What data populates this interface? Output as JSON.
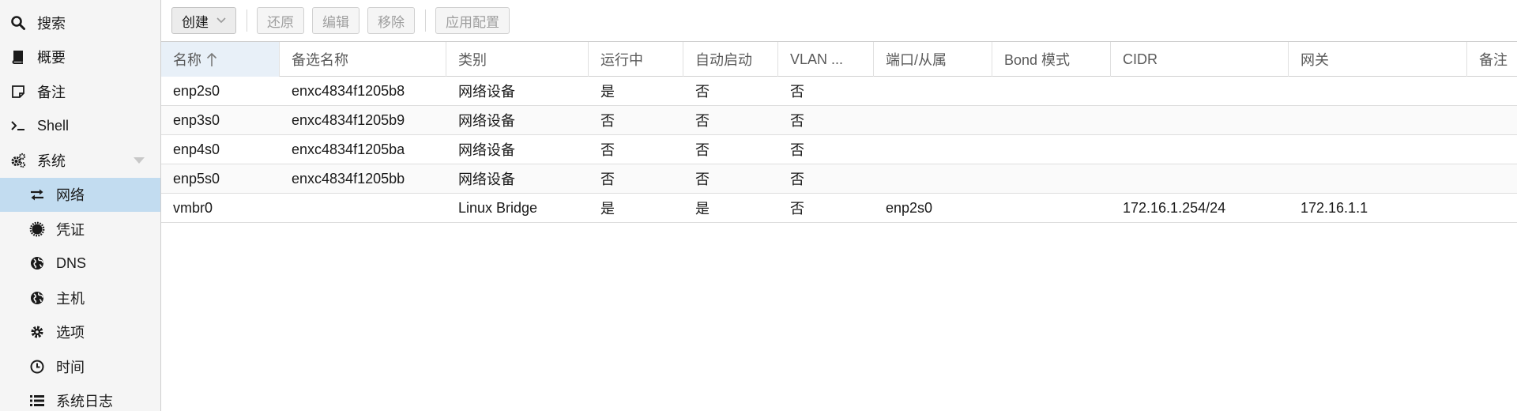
{
  "sidebar": {
    "items": [
      {
        "label": "搜索",
        "icon": "search-icon"
      },
      {
        "label": "概要",
        "icon": "book-icon"
      },
      {
        "label": "备注",
        "icon": "note-icon"
      },
      {
        "label": "Shell",
        "icon": "terminal-icon"
      },
      {
        "label": "系统",
        "icon": "cogs-icon"
      },
      {
        "label": "网络",
        "icon": "exchange-icon"
      },
      {
        "label": "凭证",
        "icon": "certificate-icon"
      },
      {
        "label": "DNS",
        "icon": "globe-icon"
      },
      {
        "label": "主机",
        "icon": "globe-icon"
      },
      {
        "label": "选项",
        "icon": "gear-icon"
      },
      {
        "label": "时间",
        "icon": "clock-icon"
      },
      {
        "label": "系统日志",
        "icon": "list-icon"
      }
    ],
    "active": "网络"
  },
  "toolbar": {
    "create_label": "创建",
    "revert_label": "还原",
    "edit_label": "编辑",
    "remove_label": "移除",
    "apply_label": "应用配置"
  },
  "table": {
    "sorted_column": "名称",
    "sort_direction": "ascending",
    "columns": [
      "名称",
      "备选名称",
      "类别",
      "运行中",
      "自动启动",
      "VLAN ...",
      "端口/从属",
      "Bond 模式",
      "CIDR",
      "网关",
      "备注"
    ],
    "rows": [
      [
        "enp2s0",
        "enxc4834f1205b8",
        "网络设备",
        "是",
        "否",
        "否",
        "",
        "",
        "",
        "",
        ""
      ],
      [
        "enp3s0",
        "enxc4834f1205b9",
        "网络设备",
        "否",
        "否",
        "否",
        "",
        "",
        "",
        "",
        ""
      ],
      [
        "enp4s0",
        "enxc4834f1205ba",
        "网络设备",
        "否",
        "否",
        "否",
        "",
        "",
        "",
        "",
        ""
      ],
      [
        "enp5s0",
        "enxc4834f1205bb",
        "网络设备",
        "否",
        "否",
        "否",
        "",
        "",
        "",
        "",
        ""
      ],
      [
        "vmbr0",
        "",
        "Linux Bridge",
        "是",
        "是",
        "否",
        "enp2s0",
        "",
        "172.16.1.254/24",
        "172.16.1.1",
        ""
      ]
    ]
  },
  "colors": {
    "sidebar_bg": "#f5f5f5",
    "active_bg": "#c2dcf0",
    "sorted_header_bg": "#e8f0f8",
    "border": "#d0d0d0"
  }
}
